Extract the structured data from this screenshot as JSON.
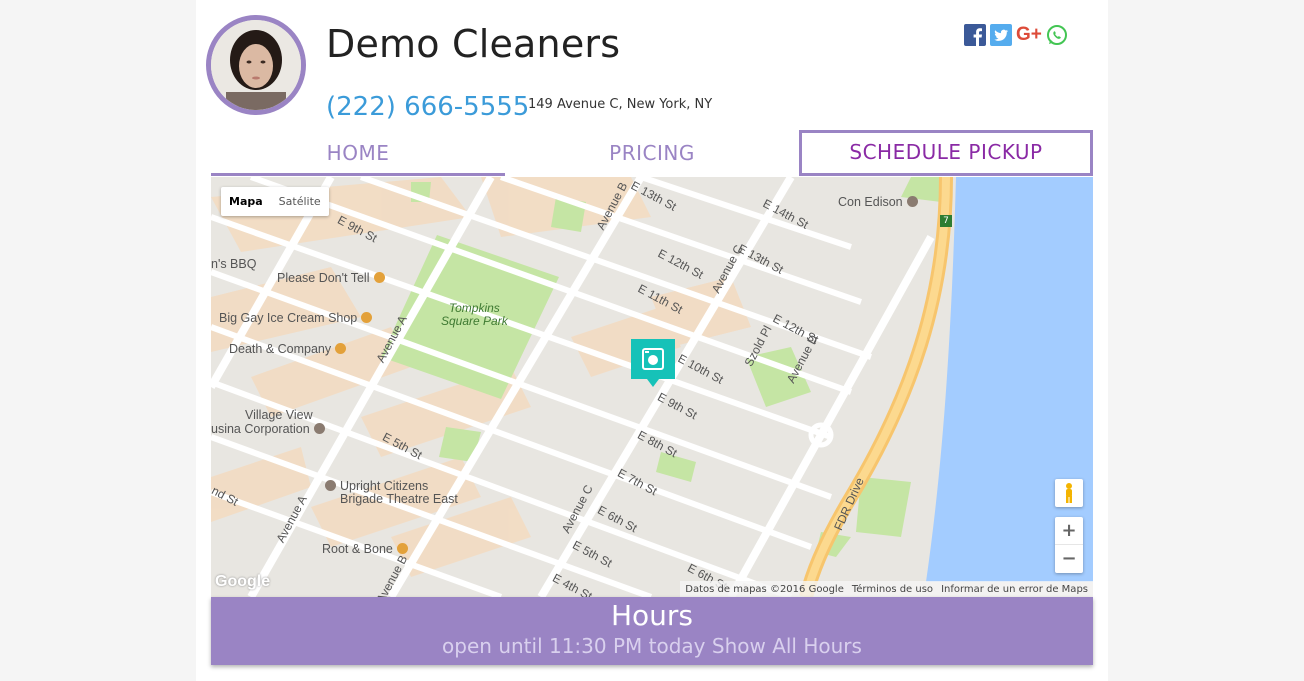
{
  "business": {
    "name": "Demo Cleaners",
    "phone": "(222) 666-5555",
    "address": "149 Avenue C, New York, NY"
  },
  "social": {
    "icons": [
      "facebook-icon",
      "twitter-icon",
      "google-plus-icon",
      "whatsapp-icon"
    ],
    "google_plus_label": "G+"
  },
  "nav": {
    "home": "HOME",
    "pricing": "PRICING",
    "schedule": "SCHEDULE PICKUP"
  },
  "map": {
    "type_map": "Mapa",
    "type_satellite": "Satélite",
    "zoom_in": "+",
    "zoom_out": "−",
    "logo": "Google",
    "attribution_data": "Datos de mapas ©2016 Google",
    "attribution_terms": "Términos de uso",
    "attribution_report": "Informar de un error de Maps",
    "park": "Tompkins Square Park",
    "streets": [
      "E 9th St",
      "E 13th St",
      "E 14th St",
      "E 12th St",
      "E 13th St",
      "E 11th St",
      "E 12th St",
      "E 10th St",
      "E 9th St",
      "E 8th St",
      "E 7th St",
      "E 6th St",
      "E 5th St",
      "E 6th St",
      "E 5th St",
      "E 4th St",
      "Avenue B",
      "Avenue C",
      "Avenue D",
      "Avenue A",
      "Avenue A",
      "Avenue C",
      "Avenue B",
      "Szold Pl",
      "FDR Drive",
      "nd St"
    ],
    "pois": {
      "bbq": "n's BBQ",
      "please": "Please Don't Tell",
      "biggay": "Big Gay Ice Cream Shop",
      "death": "Death & Company",
      "village1": "Village View",
      "village2": "usina Corporation",
      "ucb1": "Upright Citizens",
      "ucb2": "Brigade Theatre East",
      "root": "Root & Bone",
      "con": "Con Edison"
    },
    "route_badge": "7"
  },
  "hours": {
    "title": "Hours",
    "subtitle": "open until 11:30 PM today Show All Hours"
  },
  "colors": {
    "accent": "#9a84c4",
    "schedule_text": "#8a2aa5",
    "phone": "#3b9bd9",
    "marker": "#16c2b8",
    "water": "#a3ccff",
    "park": "#c5e5a4"
  }
}
